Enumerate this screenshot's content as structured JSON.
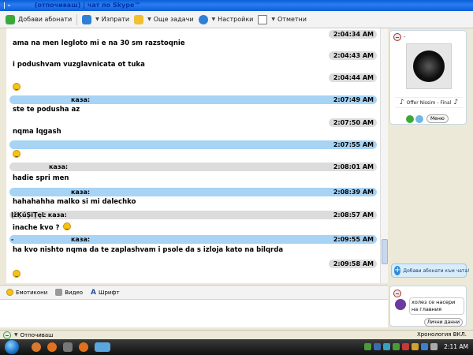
{
  "window": {
    "title_left": "| -",
    "title_mid": "(отпочиваш) | чат по Skype™"
  },
  "toolbar": {
    "add_contacts": "Добави абонати",
    "send": "Изпрати",
    "more_tasks": "Още задачи",
    "settings": "Настройки",
    "replies": "Отметни"
  },
  "messages": [
    {
      "kind": "time",
      "time": "2:04:34 AM",
      "text": "ama na men legloto mi e na 30 sm razstoqnie"
    },
    {
      "kind": "time",
      "time": "2:04:43 AM",
      "text": "i podushvam vuzglavnicata ot tuka"
    },
    {
      "kind": "time",
      "time": "2:04:44 AM",
      "emoticon": "smile"
    },
    {
      "kind": "blue",
      "name": "каза:",
      "time": "2:07:49 AM",
      "text": "ste te podusha az"
    },
    {
      "kind": "time",
      "time": "2:07:50 AM",
      "text": "nqma lqgash"
    },
    {
      "kind": "blue",
      "name": "",
      "time": "2:07:55 AM",
      "emoticon": "smile"
    },
    {
      "kind": "grey",
      "name": "каза:",
      "time": "2:08:01 AM",
      "text": "hadie spri men"
    },
    {
      "kind": "blue",
      "name": "каза:",
      "time": "2:08:39 AM",
      "text": "hahahahha malko si mi dalechko"
    },
    {
      "kind": "grey",
      "name": "ĮžĶűŞiŢęĿ каза:",
      "time": "2:08:57 AM",
      "text": "inache kvo ?"
    },
    {
      "kind": "blue",
      "name": "каза:",
      "prefix": "-",
      "time": "2:09:55 AM",
      "text": "ha kvo nishto nqma da te zaplashvam i psole da s izloja kato na bilqrda"
    },
    {
      "kind": "time",
      "time": "2:09:58 AM",
      "emoticon": "smile"
    }
  ],
  "contact": {
    "status_suffix": "-",
    "mood": "Offer Nissim - Final",
    "menu": "Меню"
  },
  "add_to_chat": "Добави абонати към чата!",
  "bottom_toolbar": {
    "emoticons": "Емотикони",
    "video": "Видео",
    "font": "Шрифт"
  },
  "card2": {
    "note": "холез се насери на главния булевард ...",
    "personal_data": "Лични данни"
  },
  "statusbar": {
    "status": "Отпочиваш",
    "history": "Хронология ВКЛ."
  },
  "taskbar": {
    "clock": "2:11 AM"
  }
}
